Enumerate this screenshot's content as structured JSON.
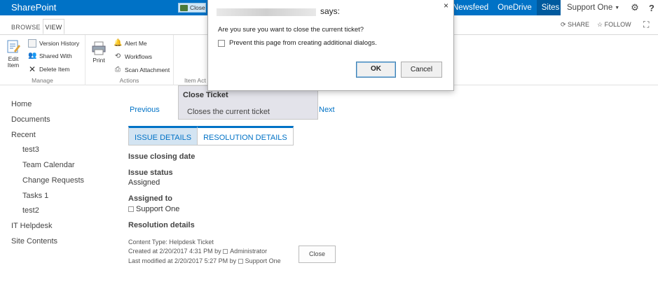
{
  "suitebar": {
    "brand": "SharePoint",
    "nav": [
      "Newsfeed",
      "OneDrive"
    ],
    "sites": "Sites",
    "user": "Support One",
    "help": "?"
  },
  "ribbon": {
    "tabs": {
      "browse": "BROWSE",
      "view": "VIEW"
    },
    "share": "SHARE",
    "follow": "FOLLOW",
    "manage": {
      "edit_item": [
        "Edit",
        "Item"
      ],
      "version_history": "Version History",
      "shared_with": "Shared With",
      "delete_item": "Delete Item",
      "label": "Manage"
    },
    "actions": {
      "print": "Print",
      "alert_me": "Alert Me",
      "workflows": "Workflows",
      "scan_attachment": "Scan Attachment",
      "label": "Actions"
    },
    "item_actions": {
      "close": "Close",
      "label": "Item Act"
    }
  },
  "tooltip": {
    "title": "Close Ticket",
    "body": "Closes the current ticket"
  },
  "leftnav": {
    "items": [
      "Home",
      "Documents",
      "Recent",
      "test3",
      "Team Calendar",
      "Change Requests",
      "Tasks 1",
      "test2",
      "IT Helpdesk",
      "Site Contents"
    ]
  },
  "content": {
    "previous": "Previous",
    "next": "Next",
    "tabs": [
      "ISSUE DETAILS",
      "RESOLUTION DETAILS"
    ],
    "issue_closing_date_label": "Issue closing date",
    "issue_status_label": "Issue status",
    "issue_status_value": "Assigned",
    "assigned_to_label": "Assigned to",
    "assigned_to_value": "Support One",
    "resolution_details_label": "Resolution details",
    "content_type": "Content Type: Helpdesk Ticket",
    "created": "Created at 2/20/2017 4:31 PM  by",
    "created_by": "Administrator",
    "modified": "Last modified at 2/20/2017 5:27 PM  by",
    "modified_by": "Support One",
    "close_button": "Close"
  },
  "dialog": {
    "says": "says:",
    "message": "Are you sure you want to close the current ticket?",
    "prevent": "Prevent this page from creating additional dialogs.",
    "ok": "OK",
    "cancel": "Cancel",
    "close_glyph": "×"
  },
  "colors": {
    "suitebar": "#0072c6",
    "link": "#0072c6",
    "tab_active": "#d3e4f2"
  }
}
